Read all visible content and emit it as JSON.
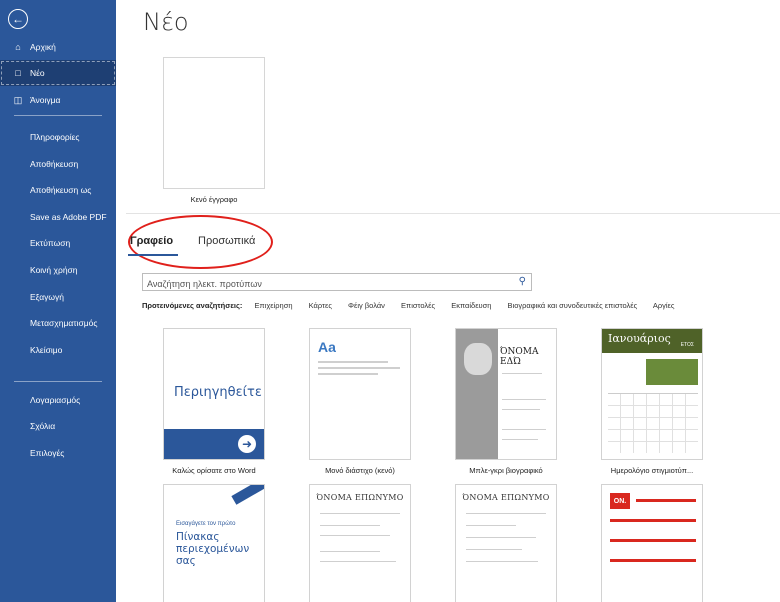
{
  "sidebar": {
    "back_icon": "back-arrow-icon",
    "items": [
      {
        "label": "Αρχική",
        "icon": "home-icon"
      },
      {
        "label": "Νέο",
        "icon": "new-document-icon"
      },
      {
        "label": "Άνοιγμα",
        "icon": "open-folder-icon"
      },
      {
        "label": "Πληροφορίες"
      },
      {
        "label": "Αποθήκευση"
      },
      {
        "label": "Αποθήκευση ως"
      },
      {
        "label": "Save as Adobe PDF"
      },
      {
        "label": "Εκτύπωση"
      },
      {
        "label": "Κοινή χρήση"
      },
      {
        "label": "Εξαγωγή"
      },
      {
        "label": "Μετασχηματισμός"
      },
      {
        "label": "Κλείσιμο"
      },
      {
        "label": "Λογαριασμός"
      },
      {
        "label": "Σχόλια"
      },
      {
        "label": "Επιλογές"
      }
    ],
    "active_index": 1,
    "color": "#2b579a"
  },
  "main": {
    "title": "Νέο",
    "blank_label": "Κενό έγγραφο",
    "tabs": [
      {
        "label": "Γραφείο",
        "active": true
      },
      {
        "label": "Προσωπικά",
        "active": false
      }
    ],
    "search": {
      "placeholder": "Αναζήτηση ηλεκτ. προτύπων",
      "icon": "search-icon"
    },
    "suggested": {
      "label": "Προτεινόμενες αναζητήσεις:",
      "items": [
        "Επιχείρηση",
        "Κάρτες",
        "Φέιγ βολάν",
        "Επιστολές",
        "Εκπαίδευση",
        "Βιογραφικά και συνοδευτικές επιστολές",
        "Αργίες"
      ]
    },
    "templates": [
      {
        "label": "Καλώς ορίσατε στο Word",
        "thumb_text": "Περιηγηθείτε"
      },
      {
        "label": "Μονό διάστιχο (κενό)",
        "thumb_text": "Aa"
      },
      {
        "label": "Μπλε-γκρι βιογραφικό",
        "thumb_text": "ΌΝΟΜΑ ΕΔΏ"
      },
      {
        "label": "Ημερολόγιο στιγμιοτύπ...",
        "thumb_text": "Ιανουάριος",
        "thumb_sub": "ΕΤΟΣ"
      }
    ],
    "templates_row2": [
      {
        "thumb_pre": "Εισαγάγετε τον πρώτο",
        "thumb_text": "Πίνακας περιεχομένων σας"
      },
      {
        "thumb_text": "ΌΝΟΜΑ ΕΠΩΝΥΜΟ"
      },
      {
        "thumb_text": "ΌΝΟΜΑ ΕΠΩΝΥΜΟ"
      },
      {
        "thumb_text": "ON."
      }
    ],
    "highlight_color": "#e0201b"
  }
}
